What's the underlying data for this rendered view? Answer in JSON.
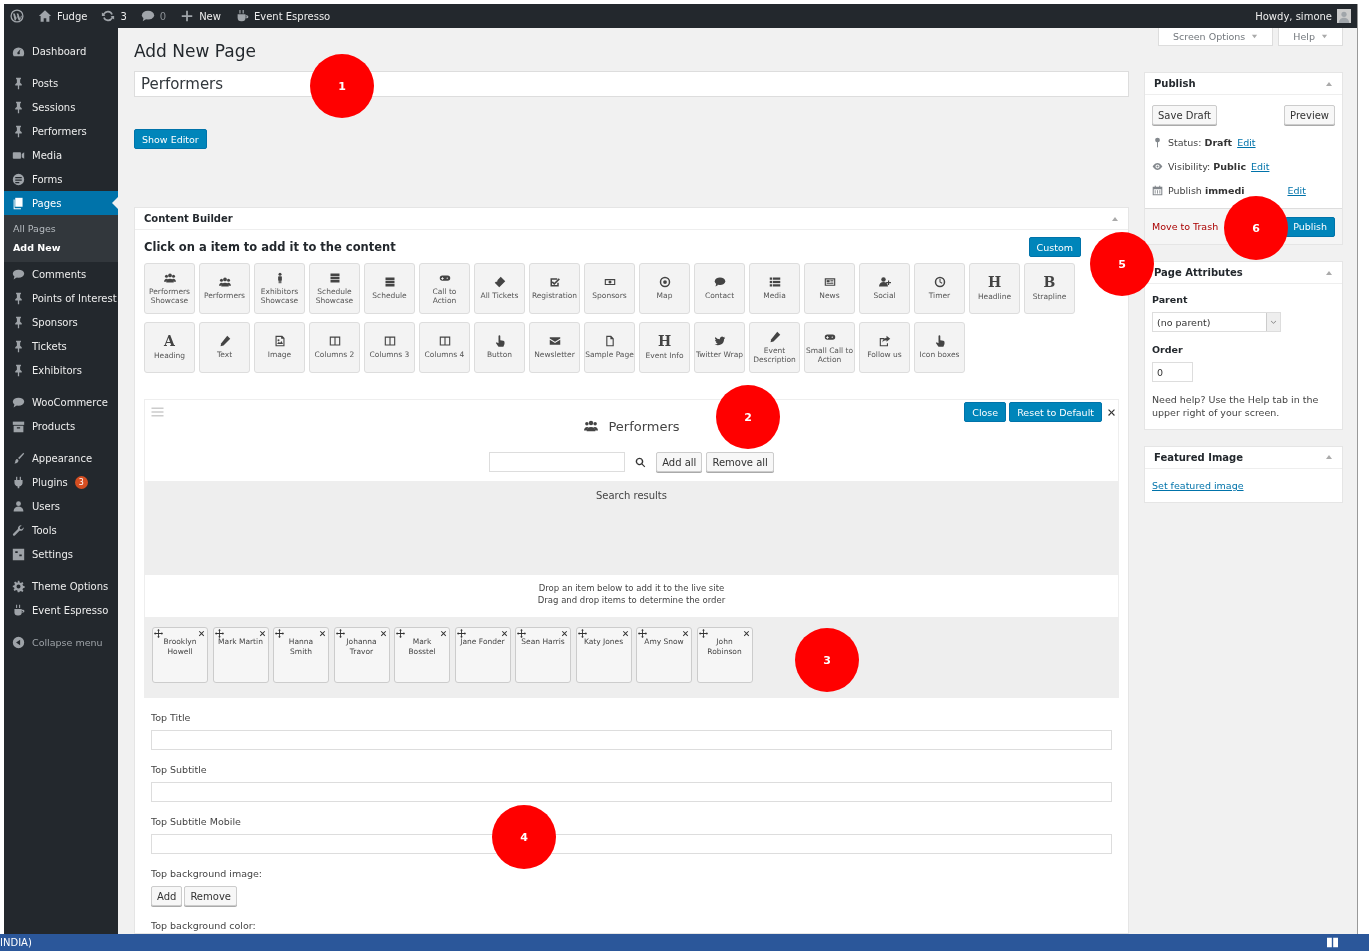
{
  "admin_bar": {
    "site": "Fudge",
    "updates": "3",
    "comments": "0",
    "new": "New",
    "plugin": "Event Espresso",
    "greeting": "Howdy, simone"
  },
  "screen_tabs": [
    "Screen Options",
    "Help"
  ],
  "sidebar": {
    "sections": [
      [
        {
          "label": "Dashboard",
          "selected": false
        }
      ],
      [
        {
          "label": "Posts",
          "selected": false
        },
        {
          "label": "Sessions",
          "selected": false
        },
        {
          "label": "Performers",
          "selected": false
        },
        {
          "label": "Media",
          "selected": false
        },
        {
          "label": "Forms",
          "selected": false
        },
        {
          "label": "Pages",
          "selected": true,
          "children": [
            {
              "label": "All Pages",
              "selected": false
            },
            {
              "label": "Add New",
              "selected": true
            }
          ]
        },
        {
          "label": "Comments",
          "selected": false
        },
        {
          "label": "Points of Interest",
          "selected": false
        },
        {
          "label": "Sponsors",
          "selected": false
        },
        {
          "label": "Tickets",
          "selected": false
        },
        {
          "label": "Exhibitors",
          "selected": false
        }
      ],
      [
        {
          "label": "WooCommerce",
          "selected": false
        },
        {
          "label": "Products",
          "selected": false
        }
      ],
      [
        {
          "label": "Appearance",
          "selected": false
        },
        {
          "label": "Plugins",
          "selected": false,
          "badge": "3"
        },
        {
          "label": "Users",
          "selected": false
        },
        {
          "label": "Tools",
          "selected": false
        },
        {
          "label": "Settings",
          "selected": false
        }
      ],
      [
        {
          "label": "Theme Options",
          "selected": false
        },
        {
          "label": "Event Espresso",
          "selected": false
        }
      ]
    ],
    "collapse": "Collapse menu"
  },
  "page": {
    "heading": "Add New Page",
    "title_value": "Performers",
    "editor_button": "Show Editor"
  },
  "content_builder": {
    "title": "Content Builder",
    "instruction": "Click on a item to add it to the content",
    "custom_button": "Custom",
    "tile_rows": [
      [
        {
          "label": "Performers Showcase"
        },
        {
          "label": "Performers"
        },
        {
          "label": "Exhibitors Showcase"
        },
        {
          "label": "Schedule Showcase"
        },
        {
          "label": "Schedule"
        },
        {
          "label": "Call to Action"
        },
        {
          "label": "All Tickets"
        },
        {
          "label": "Registration"
        },
        {
          "label": "Sponsors"
        },
        {
          "label": "Map"
        },
        {
          "label": "Contact"
        },
        {
          "label": "Media"
        },
        {
          "label": "News"
        },
        {
          "label": "Social"
        },
        {
          "label": "Timer"
        },
        {
          "label": "Headline",
          "glyph": "H"
        },
        {
          "label": "Strapline",
          "glyph": "B"
        }
      ],
      [
        {
          "label": "Heading",
          "glyph": "A"
        },
        {
          "label": "Text"
        },
        {
          "label": "Image"
        },
        {
          "label": "Columns 2"
        },
        {
          "label": "Columns 3"
        },
        {
          "label": "Columns 4"
        },
        {
          "label": "Button"
        },
        {
          "label": "Newsletter"
        },
        {
          "label": "Sample Page"
        },
        {
          "label": "Event Info",
          "glyph": "H"
        },
        {
          "label": "Twitter Wrap"
        },
        {
          "label": "Event Description"
        },
        {
          "label": "Small Call to Action"
        },
        {
          "label": "Follow us"
        },
        {
          "label": "Icon boxes"
        }
      ]
    ]
  },
  "module": {
    "title": "Performers",
    "buttons": [
      "Close",
      "Reset to Default"
    ],
    "add_all": "Add all",
    "remove_all": "Remove all",
    "results_label": "Search results",
    "hint_lines": [
      "Drop an item below to add it to the live site",
      "Drag and drop items to determine the order"
    ],
    "items": [
      "Brooklyn Howell",
      "Mark Martin",
      "Hanna Smith",
      "Johanna Travor",
      "Mark Bosstel",
      "Jane Fonder",
      "Sean Harris",
      "Katy Jones",
      "Amy Snow",
      "John Robinson"
    ]
  },
  "fields": [
    {
      "kind": "text",
      "label": "Top Title"
    },
    {
      "kind": "text",
      "label": "Top Subtitle"
    },
    {
      "kind": "text",
      "label": "Top Subtitle Mobile"
    },
    {
      "kind": "image",
      "label": "Top background image:",
      "buttons": [
        "Add",
        "Remove"
      ]
    },
    {
      "kind": "label",
      "label": "Top background color:"
    }
  ],
  "publish": {
    "title": "Publish",
    "save_draft": "Save Draft",
    "preview": "Preview",
    "rows": [
      {
        "kind": "status",
        "label": "Status:",
        "value": "Draft",
        "link": "Edit"
      },
      {
        "kind": "visibility",
        "label": "Visibility:",
        "value": "Public",
        "link": "Edit"
      },
      {
        "kind": "schedule",
        "label": "Publish",
        "value": "immedi",
        "link": "Edit"
      }
    ],
    "trash": "Move to Trash",
    "publish_button": "Publish"
  },
  "page_attributes": {
    "title": "Page Attributes",
    "parent_label": "Parent",
    "parent_value": "(no parent)",
    "order_label": "Order",
    "order_value": "0",
    "help": "Need help? Use the Help tab in the upper right of your screen."
  },
  "featured_image": {
    "title": "Featured Image",
    "link": "Set featured image"
  },
  "callouts": [
    "1",
    "2",
    "3",
    "4",
    "5",
    "6"
  ],
  "status_bar": {
    "language": "INDIA)"
  }
}
